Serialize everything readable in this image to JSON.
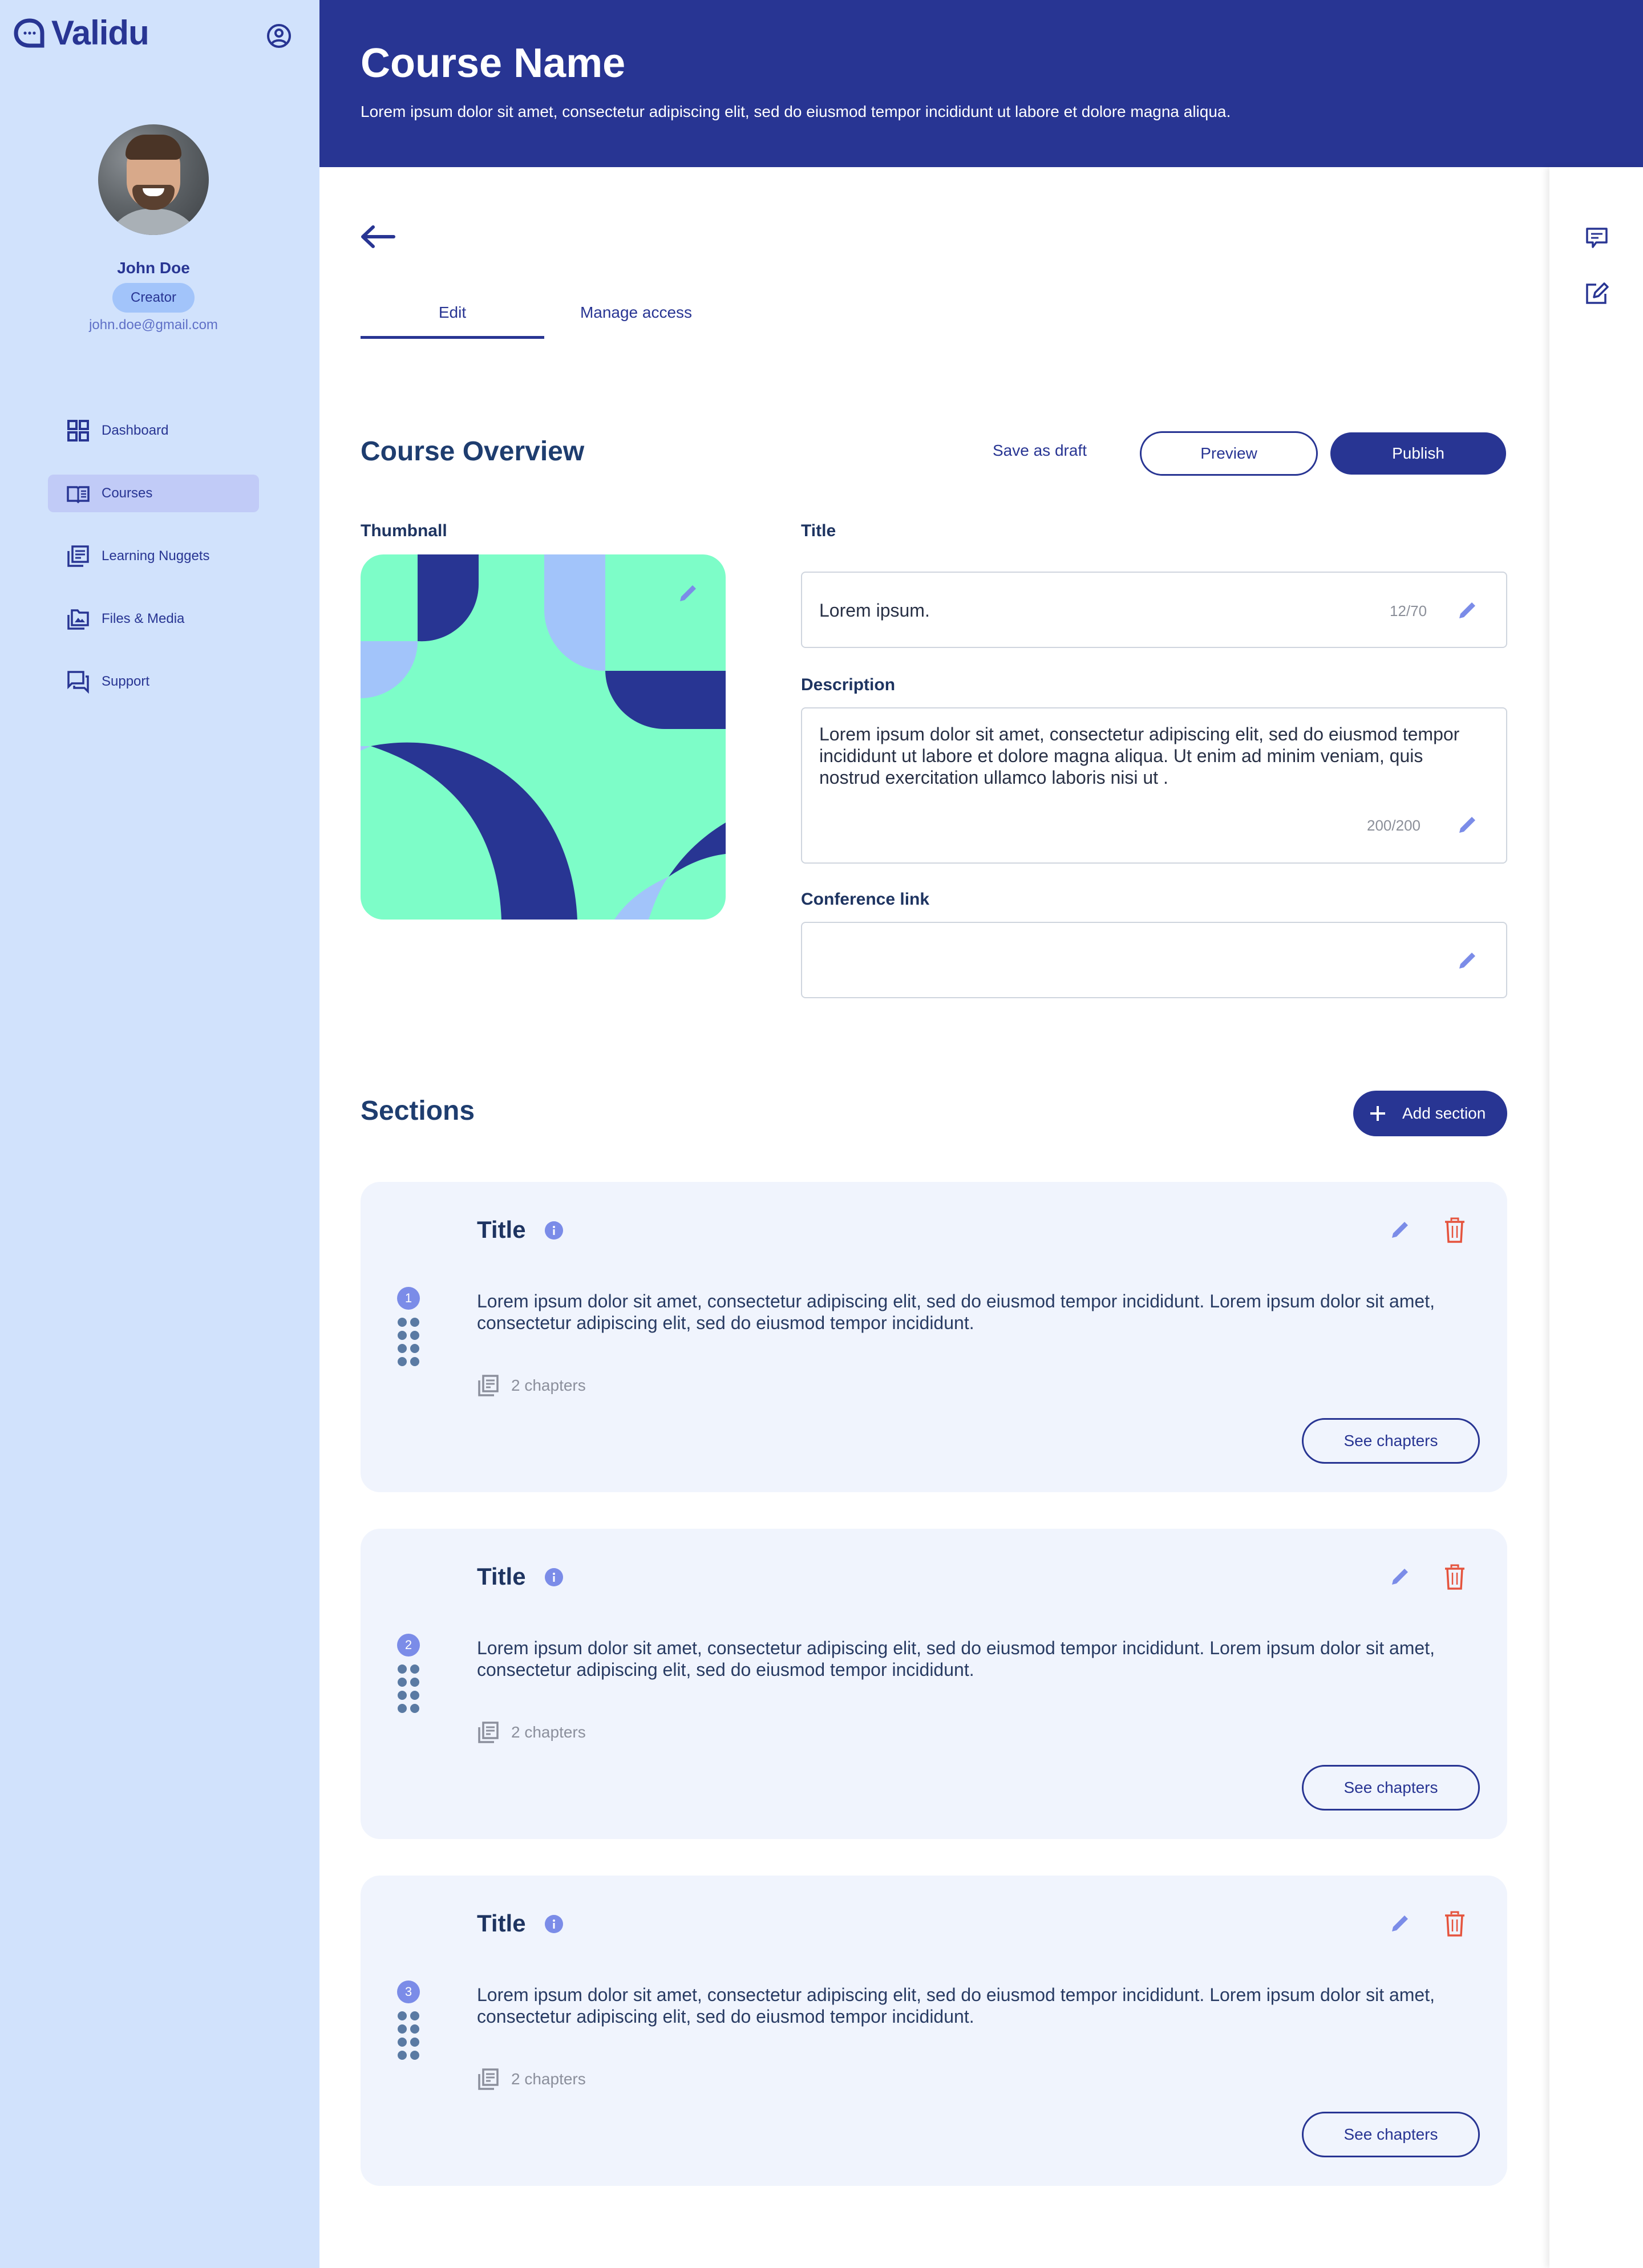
{
  "brand": {
    "name": "Validu"
  },
  "colors": {
    "primary": "#283593",
    "sidebar_bg": "#d1e2fc",
    "accent_light": "#7b8ce8",
    "danger": "#e5533d",
    "thumb_mint": "#7dfdc8",
    "thumb_lavender": "#a2c4fa"
  },
  "user": {
    "name": "John Doe",
    "role": "Creator",
    "email": "john.doe@gmail.com"
  },
  "sidebar": {
    "items": [
      {
        "label": "Dashboard",
        "icon": "dashboard-grid-icon",
        "active": false
      },
      {
        "label": "Courses",
        "icon": "open-book-icon",
        "active": true
      },
      {
        "label": "Learning Nuggets",
        "icon": "stacked-documents-icon",
        "active": false
      },
      {
        "label": "Files & Media",
        "icon": "image-folder-icon",
        "active": false
      },
      {
        "label": "Support",
        "icon": "chat-bubbles-icon",
        "active": false
      }
    ]
  },
  "header": {
    "title": "Course Name",
    "subtitle": "Lorem ipsum dolor sit amet, consectetur adipiscing elit, sed do eiusmod tempor incididunt ut labore et dolore magna aliqua."
  },
  "tabs": [
    {
      "label": "Edit",
      "active": true
    },
    {
      "label": "Manage access",
      "active": false
    }
  ],
  "overview": {
    "title": "Course Overview",
    "save_draft_label": "Save as draft",
    "preview_label": "Preview",
    "publish_label": "Publish",
    "thumbnail_label": "Thumbnall",
    "title_label": "Title",
    "title_value": "Lorem ipsum.",
    "title_counter": "12/70",
    "description_label": "Description",
    "description_value": "Lorem ipsum dolor sit amet, consectetur adipiscing elit, sed do eiusmod tempor incididunt ut labore et dolore magna aliqua. Ut enim ad minim veniam, quis nostrud exercitation ullamco laboris nisi ut .",
    "description_counter": "200/200",
    "conference_label": "Conference link",
    "conference_value": ""
  },
  "sections": {
    "title": "Sections",
    "add_label": "Add section",
    "items": [
      {
        "number": "1",
        "title": "Title",
        "description": "Lorem ipsum dolor sit amet, consectetur adipiscing elit, sed do eiusmod tempor incididunt. Lorem ipsum dolor sit amet, consectetur adipiscing elit, sed do eiusmod tempor incididunt.",
        "chapters": "2 chapters",
        "see_label": "See chapters"
      },
      {
        "number": "2",
        "title": "Title",
        "description": "Lorem ipsum dolor sit amet, consectetur adipiscing elit, sed do eiusmod tempor incididunt. Lorem ipsum dolor sit amet, consectetur adipiscing elit, sed do eiusmod tempor incididunt.",
        "chapters": "2 chapters",
        "see_label": "See chapters"
      },
      {
        "number": "3",
        "title": "Title",
        "description": "Lorem ipsum dolor sit amet, consectetur adipiscing elit, sed do eiusmod tempor incididunt. Lorem ipsum dolor sit amet, consectetur adipiscing elit, sed do eiusmod tempor incididunt.",
        "chapters": "2 chapters",
        "see_label": "See chapters"
      }
    ]
  },
  "rail": {
    "items": [
      {
        "icon": "comment-icon"
      },
      {
        "icon": "edit-note-icon"
      }
    ]
  }
}
